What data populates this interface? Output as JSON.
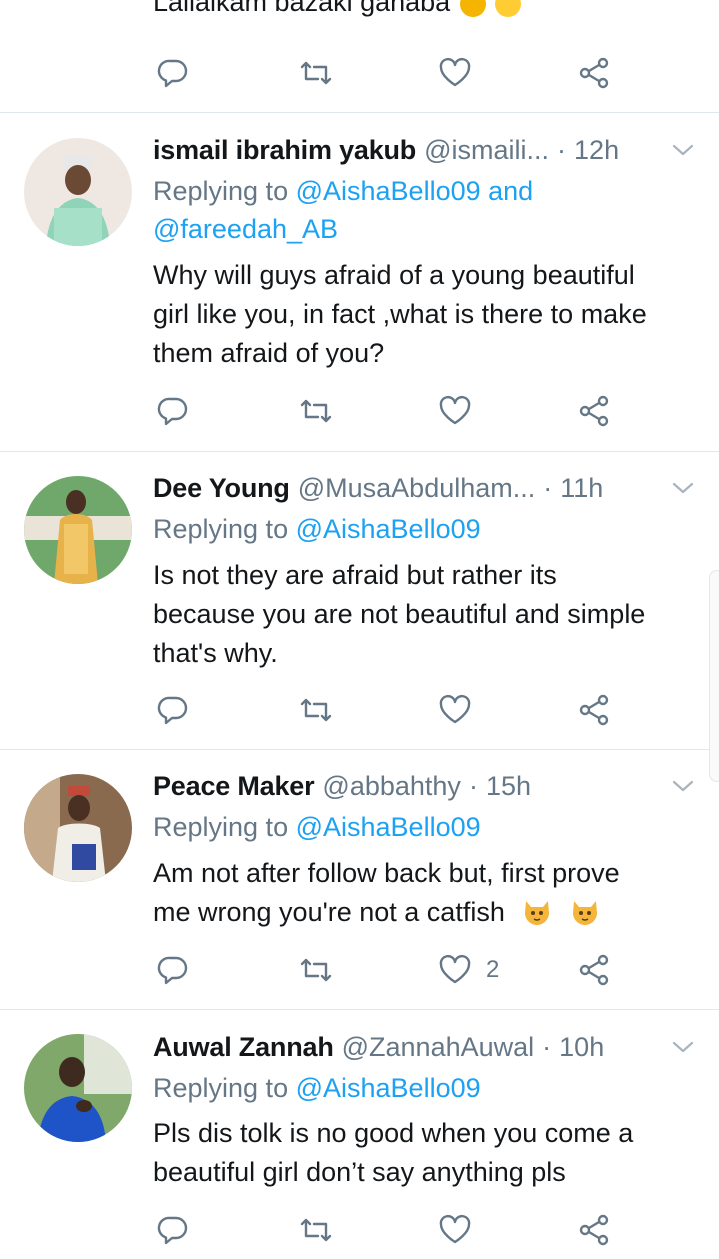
{
  "partial_tweet": {
    "text": "Lallaikam  bazaki ganaba"
  },
  "tweets": [
    {
      "name": "ismail ibrahim yakub",
      "handle": "@ismaili...",
      "time": "12h",
      "replying_prefix": "Replying to ",
      "mentions": "@AishaBello09 and",
      "mentions2": "@fareedah_AB",
      "body_lines": [
        "Why will guys afraid of a young beautiful",
        "girl like you, in fact ,what is there to make",
        "them afraid of you?"
      ],
      "like_count": ""
    },
    {
      "name": "Dee Young",
      "handle": "@MusaAbdulham...",
      "time": "11h",
      "replying_prefix": "Replying to ",
      "mentions": "@AishaBello09",
      "body_lines": [
        "Is not they are afraid but rather its",
        "because you are not beautiful and simple",
        "that's why."
      ],
      "like_count": ""
    },
    {
      "name": "Peace Maker",
      "handle": "@abbahthy",
      "time": "15h",
      "replying_prefix": "Replying to ",
      "mentions": "@AishaBello09",
      "body_lines": [
        "Am not after follow back but, first prove",
        "me wrong you're not a catfish"
      ],
      "like_count": "2"
    },
    {
      "name": "Auwal Zannah",
      "handle": "@ZannahAuwal",
      "time": "10h",
      "replying_prefix": "Replying to ",
      "mentions": "@AishaBello09",
      "body_lines": [
        "Pls dis tolk is no good when you come a",
        "beautiful girl don’t say anything pls"
      ],
      "like_count": ""
    }
  ],
  "icons": {
    "reply": "reply-icon",
    "retweet": "retweet-icon",
    "like": "heart-icon",
    "share": "share-icon",
    "caret": "chevron-down-icon",
    "emoji": "cat-emoji-icon"
  },
  "colors": {
    "link": "#1da1f2",
    "muted": "#657786",
    "text": "#14171a",
    "divider": "#e1e8ed"
  }
}
